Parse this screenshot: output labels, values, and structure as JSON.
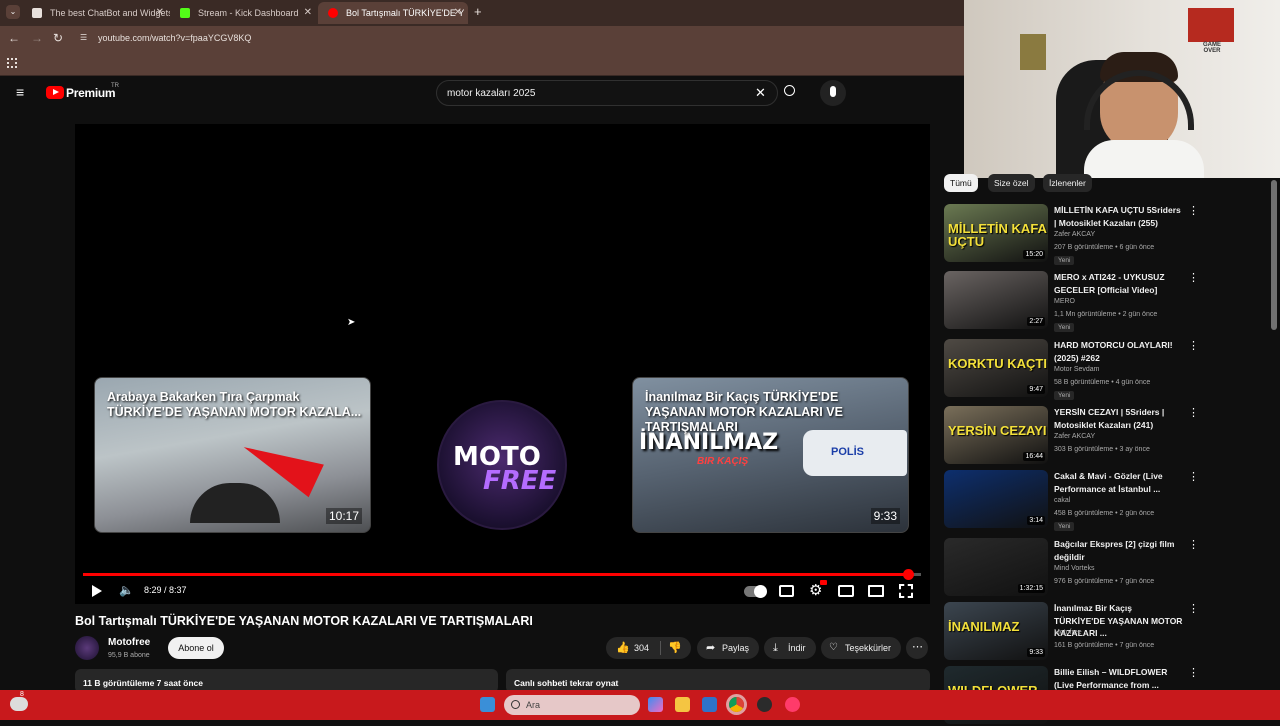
{
  "browser": {
    "tabs": [
      {
        "label": "The best ChatBot and Widgets",
        "color": "#e8e0dc"
      },
      {
        "label": "Stream - Kick Dashboard",
        "color": "#53fc18"
      },
      {
        "label": "Bol Tartışmalı TÜRKİYE'DE Y",
        "color": "#ff0000"
      }
    ],
    "url": "youtube.com/watch?v=fpaaYCGV8KQ"
  },
  "youtube": {
    "logo_text": "Premium",
    "logo_badge": "TR",
    "search_value": "motor kazaları 2025"
  },
  "player": {
    "endcards": [
      {
        "title": "Arabaya Bakarken Tıra Çarpmak TÜRKİYE'DE YAŞANAN MOTOR KAZALA...",
        "duration": "10:17"
      },
      {
        "title": "İnanılmaz Bir Kaçış TÜRKİYE'DE YAŞANAN MOTOR KAZALARI VE TARTIŞMALARI",
        "duration": "9:33"
      }
    ],
    "channel_logo_text_1": "MOTO",
    "channel_logo_text_2": "FREE",
    "endcard2_overlay": "İNANILMAZ",
    "endcard2_overlay_sub": "BIR KAÇIŞ",
    "endcard2_police": "POLİS",
    "time": "8:29 / 8:37",
    "progress": 0.985
  },
  "video": {
    "title": "Bol Tartışmalı TÜRKİYE'DE YAŞANAN MOTOR KAZALARI VE TARTIŞMALARI",
    "channel": "Motofree",
    "subscribers": "95,9 B abone",
    "subscribe_label": "Abone ol",
    "likes": "304",
    "share_label": "Paylaş",
    "download_label": "İndir",
    "thanks_label": "Teşekkürler",
    "views_line": "11 B görüntüleme  7 saat önce",
    "chat_replay": "Canlı sohbeti tekrar oynat"
  },
  "sidebar": {
    "chips": [
      "Tümü",
      "Size özel",
      "İzlenenler"
    ],
    "items": [
      {
        "title": "MİLLETİN KAFA UÇTU 5Sriders | Motosiklet Kazaları (255)",
        "channel": "Zafer AKCAY",
        "meta": "207 B görüntüleme • 6 gün önce",
        "badge": "Yeni",
        "duration": "15:20",
        "thumb_text": "MİLLETİN KAFA UÇTU",
        "bg": "#6b7a52"
      },
      {
        "title": "MERO x ATI242 - UYKUSUZ GECELER [Official Video]",
        "channel": "MERO",
        "meta": "1,1 Mn görüntüleme • 2 gün önce",
        "badge": "Yeni",
        "duration": "2:27",
        "thumb_text": "",
        "bg": "#6a6462"
      },
      {
        "title": "HARD MOTORCU OLAYLARI! (2025) #262",
        "channel": "Motor Sevdam",
        "meta": "58 B görüntüleme • 4 gün önce",
        "badge": "Yeni",
        "duration": "9:47",
        "thumb_text": "KORKTU KAÇTI",
        "bg": "#4f4a44"
      },
      {
        "title": "YERSİN CEZAYI | 5Sriders | Motosiklet Kazaları (241)",
        "channel": "Zafer AKCAY",
        "meta": "303 B görüntüleme • 3 ay önce",
        "badge": "",
        "duration": "16:44",
        "thumb_text": "YERSİN CEZAYI",
        "bg": "#7a6f5a"
      },
      {
        "title": "Cakal & Mavi - Gözler (Live Performance at İstanbul ...",
        "channel": "cakal",
        "meta": "458 B görüntüleme • 2 gün önce",
        "badge": "Yeni",
        "duration": "3:14",
        "thumb_text": "",
        "bg": "#0d2f6e"
      },
      {
        "title": "Bağcılar Ekspres [2] çizgi film değildir",
        "channel": "Mind Vorteks",
        "meta": "976 B görüntüleme • 7 gün önce",
        "badge": "",
        "duration": "1:32:15",
        "thumb_text": "",
        "bg": "#2a2a2a"
      },
      {
        "title": "İnanılmaz Bir Kaçış TÜRKİYE'DE YAŞANAN MOTOR KAZALARI ...",
        "channel": "Motofree",
        "meta": "161 B görüntüleme • 7 gün önce",
        "badge": "",
        "duration": "9:33",
        "thumb_text": "İNANILMAZ",
        "bg": "#3c4650"
      },
      {
        "title": "Billie Eilish – WILDFLOWER (Live Performance from ...",
        "channel": "",
        "meta": "",
        "badge": "",
        "duration": "",
        "thumb_text": "WILDFLOWER",
        "bg": "#1f2a2e"
      }
    ]
  },
  "webcam": {
    "poster_text": "GAME OVER"
  },
  "taskbar": {
    "search_placeholder": "Ara",
    "weather_badge": "8"
  }
}
